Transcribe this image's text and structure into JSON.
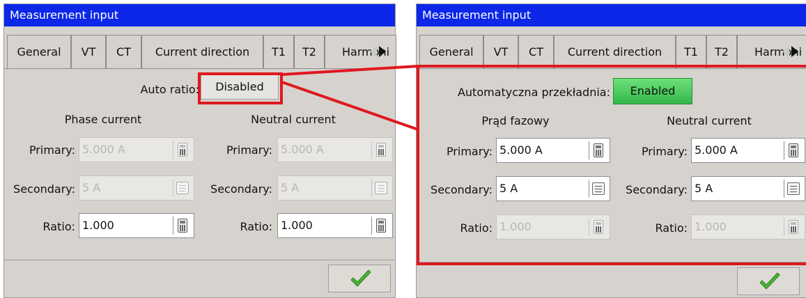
{
  "left": {
    "title": "Measurement input",
    "tabs": [
      "General",
      "VT",
      "CT",
      "Current direction",
      "T1",
      "T2",
      "Harmoni"
    ],
    "auto_ratio_label": "Auto ratio:",
    "auto_ratio_value": "Disabled",
    "phase_header": "Phase current",
    "neutral_header": "Neutral current",
    "primary_label": "Primary:",
    "secondary_label": "Secondary:",
    "ratio_label": "Ratio:",
    "phase": {
      "primary": "5.000 A",
      "secondary": "5 A",
      "ratio": "1.000"
    },
    "neutral": {
      "primary": "5.000 A",
      "secondary": "5 A",
      "ratio": "1.000"
    }
  },
  "right": {
    "title": "Measurement input",
    "tabs": [
      "General",
      "VT",
      "CT",
      "Current direction",
      "T1",
      "T2",
      "Harmoni"
    ],
    "auto_ratio_label": "Automatyczna przekładnia:",
    "auto_ratio_value": "Enabled",
    "phase_header": "Prąd fazowy",
    "neutral_header": "Neutral current",
    "primary_label": "Primary:",
    "secondary_label": "Secondary:",
    "ratio_label": "Ratio:",
    "phase": {
      "primary": "5.000 A",
      "secondary": "5 A",
      "ratio": "1.000"
    },
    "neutral": {
      "primary": "5.000 A",
      "secondary": "5 A",
      "ratio": "1.000"
    }
  },
  "colors": {
    "titlebar": "#0c27e8",
    "highlight": "#e0181f",
    "enabled_button": "#3fc055",
    "ok_check": "#49b535"
  }
}
